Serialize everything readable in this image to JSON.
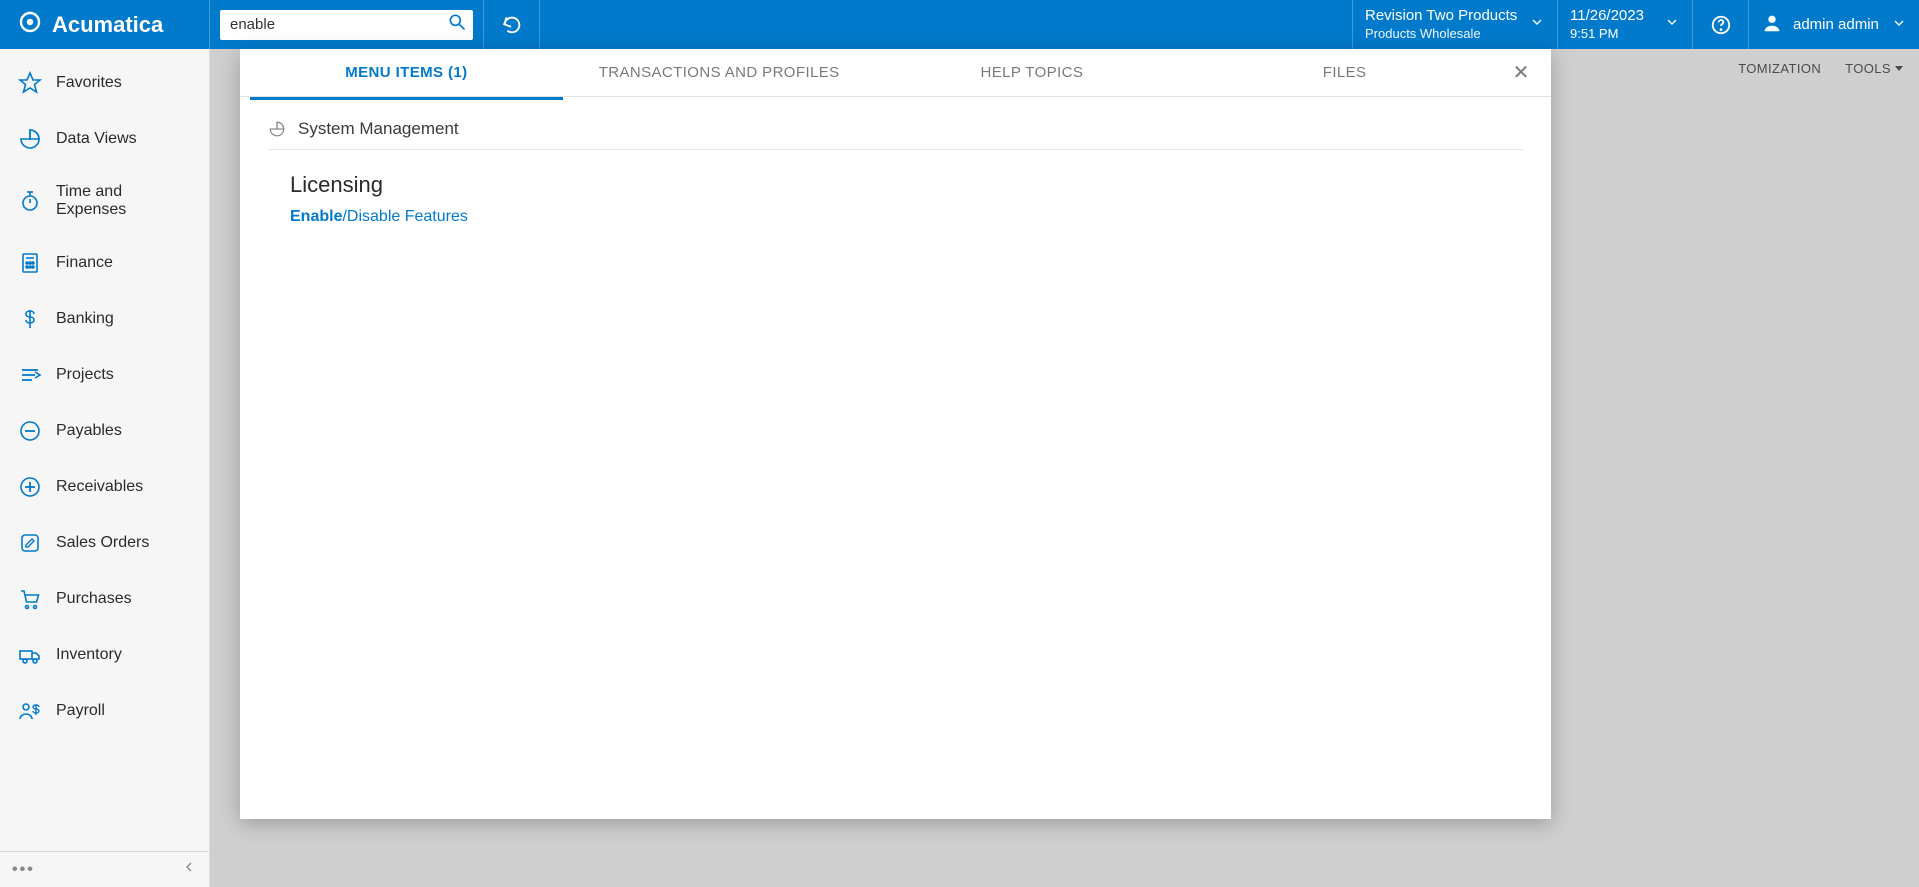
{
  "brand": {
    "name": "Acumatica"
  },
  "search": {
    "value": "enable"
  },
  "tenant": {
    "line1": "Revision Two Products",
    "line2": "Products Wholesale"
  },
  "datetime": {
    "date": "11/26/2023",
    "time": "9:51 PM"
  },
  "user": {
    "name": "admin admin"
  },
  "top_actions": {
    "customization": "TOMIZATION",
    "tools": "TOOLS"
  },
  "sidebar": {
    "items": [
      {
        "label": "Favorites",
        "icon": "star"
      },
      {
        "label": "Data Views",
        "icon": "pie"
      },
      {
        "label": "Time and Expenses",
        "icon": "stopwatch"
      },
      {
        "label": "Finance",
        "icon": "calculator"
      },
      {
        "label": "Banking",
        "icon": "dollar"
      },
      {
        "label": "Projects",
        "icon": "layers"
      },
      {
        "label": "Payables",
        "icon": "minus-circle"
      },
      {
        "label": "Receivables",
        "icon": "plus-circle"
      },
      {
        "label": "Sales Orders",
        "icon": "edit-square"
      },
      {
        "label": "Purchases",
        "icon": "cart"
      },
      {
        "label": "Inventory",
        "icon": "truck"
      },
      {
        "label": "Payroll",
        "icon": "people-dollar"
      }
    ]
  },
  "panel": {
    "tabs": {
      "menu_items": "MENU ITEMS  (1)",
      "transactions": "TRANSACTIONS AND PROFILES",
      "help": "HELP TOPICS",
      "files": "FILES"
    },
    "close": "✕",
    "category": "System Management",
    "group": "Licensing",
    "result": {
      "highlight": "Enable",
      "rest": "/Disable Features"
    }
  }
}
